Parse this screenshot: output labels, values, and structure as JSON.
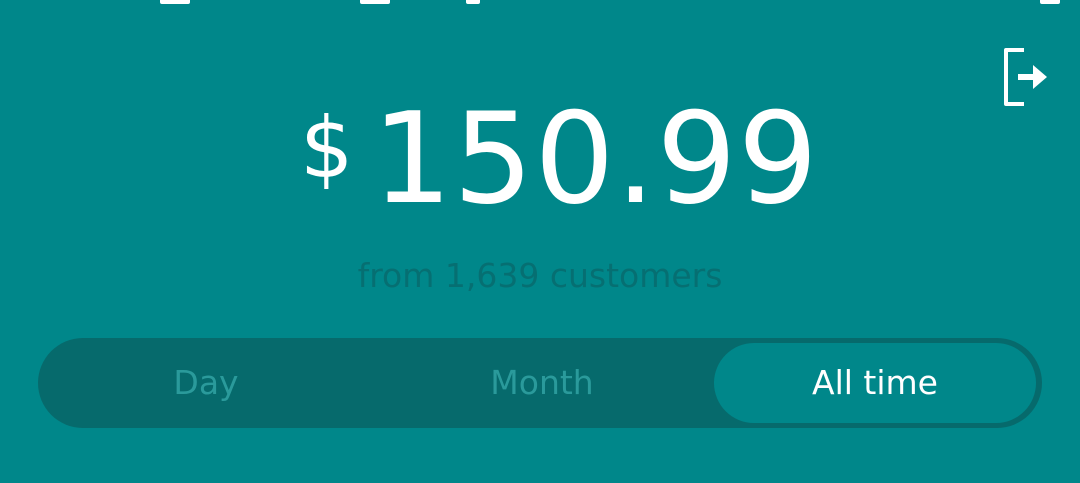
{
  "header": {
    "logout_icon": "logout-icon"
  },
  "summary": {
    "currency_symbol": "$",
    "amount": "150.99",
    "subtitle": "from 1,639 customers"
  },
  "period_tabs": {
    "items": [
      {
        "label": "Day",
        "selected": false
      },
      {
        "label": "Month",
        "selected": false
      },
      {
        "label": "All time",
        "selected": true
      }
    ]
  },
  "colors": {
    "background": "#00878a",
    "track": "#066a6c",
    "inactive_text": "#2a9a9b",
    "subtitle_text": "#066f72",
    "active_text": "#ffffff"
  }
}
